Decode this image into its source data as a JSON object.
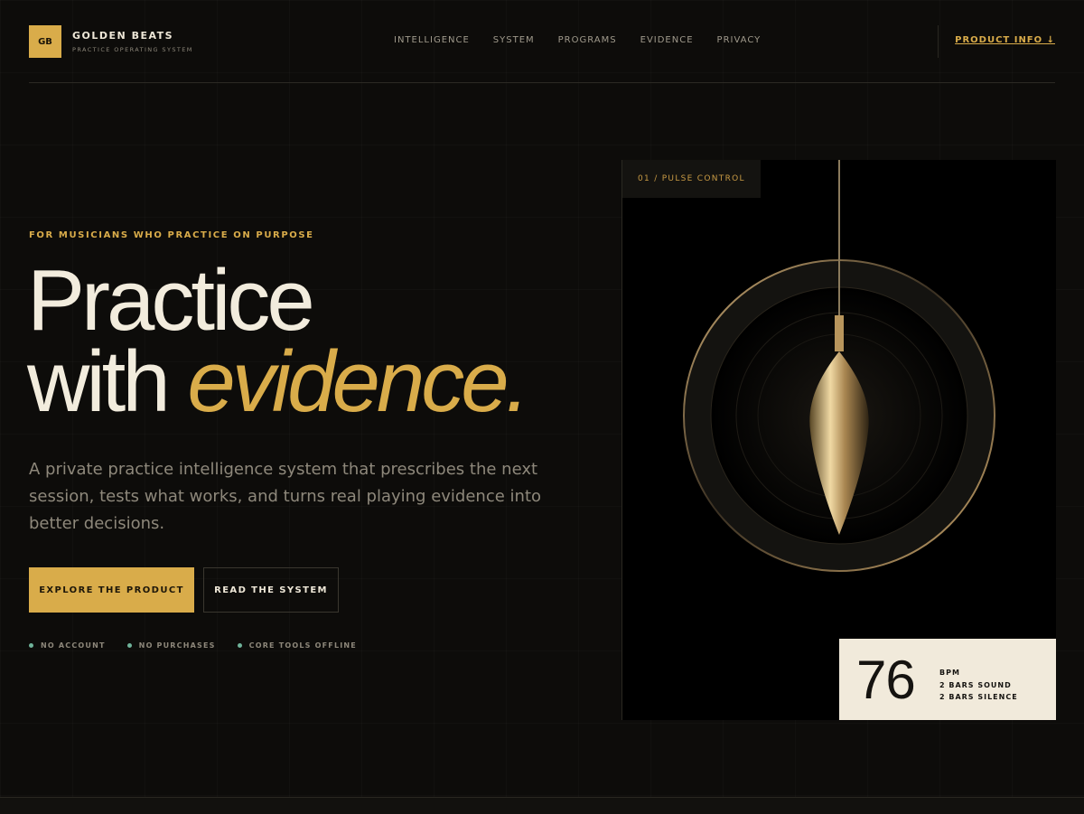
{
  "brand": {
    "logo": "GB",
    "name": "GOLDEN BEATS",
    "tagline": "PRACTICE OPERATING SYSTEM"
  },
  "nav": {
    "items": [
      "INTELLIGENCE",
      "SYSTEM",
      "PROGRAMS",
      "EVIDENCE",
      "PRIVACY"
    ],
    "product_info": "PRODUCT INFO ↓"
  },
  "hero": {
    "eyebrow": "FOR MUSICIANS WHO PRACTICE ON PURPOSE",
    "title_line1": "Practice",
    "title_line2_plain": "with ",
    "title_line2_accent": "evidence.",
    "lede": "A private practice intelligence system that prescribes the next session, tests what works, and turns real playing evidence into better decisions.",
    "primary_cta": "EXPLORE THE PRODUCT",
    "secondary_cta": "READ THE SYSTEM",
    "trust": [
      "NO ACCOUNT",
      "NO PURCHASES",
      "CORE TOOLS OFFLINE"
    ]
  },
  "panel": {
    "tag": "01 / PULSE CONTROL",
    "bpm": "76",
    "bpm_unit": "BPM",
    "bars_sound": "2 BARS SOUND",
    "bars_silence": "2 BARS SILENCE"
  },
  "colors": {
    "accent": "#d9ac4a",
    "background": "#0d0c0a",
    "status": "#6fb39a",
    "card": "#f1eadb"
  }
}
